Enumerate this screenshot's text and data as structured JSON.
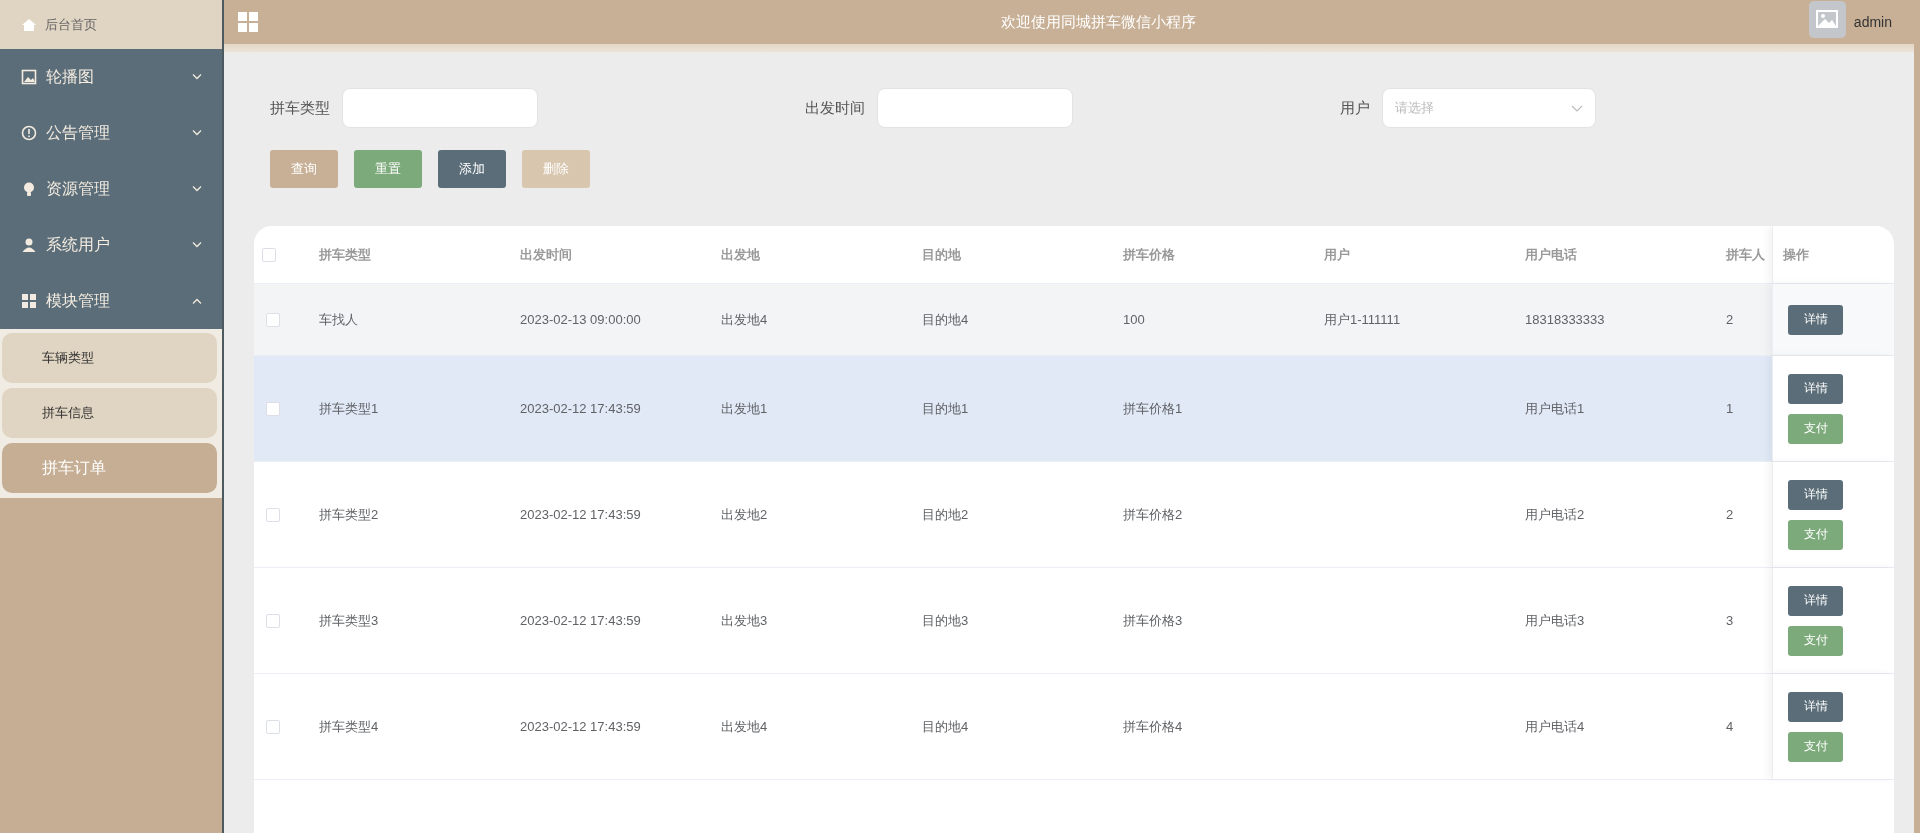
{
  "sidebar": {
    "home": {
      "label": "后台首页"
    },
    "items": [
      {
        "label": "轮播图",
        "expanded": false
      },
      {
        "label": "公告管理",
        "expanded": false
      },
      {
        "label": "资源管理",
        "expanded": false
      },
      {
        "label": "系统用户",
        "expanded": false
      },
      {
        "label": "模块管理",
        "expanded": true,
        "children": [
          {
            "label": "车辆类型",
            "selected": false
          },
          {
            "label": "拼车信息",
            "selected": false
          },
          {
            "label": "拼车订单",
            "selected": true
          }
        ]
      }
    ]
  },
  "header": {
    "title": "欢迎使用同城拼车微信小程序",
    "user": "admin"
  },
  "filters": [
    {
      "label": "拼车类型",
      "kind": "input"
    },
    {
      "label": "出发时间",
      "kind": "input"
    },
    {
      "label": "用户",
      "kind": "select",
      "placeholder": "请选择"
    }
  ],
  "buttons": [
    {
      "label": "查询",
      "kind": "search",
      "disabled": false
    },
    {
      "label": "重置",
      "kind": "reset",
      "disabled": false
    },
    {
      "label": "添加",
      "kind": "add",
      "disabled": false
    },
    {
      "label": "删除",
      "kind": "delete",
      "disabled": true
    }
  ],
  "table": {
    "select_all": {
      "checked": false
    },
    "columns": [
      "拼车类型",
      "出发时间",
      "出发地",
      "目的地",
      "拼车价格",
      "用户",
      "用户电话",
      "拼车人"
    ],
    "action_column": "操作",
    "rows": [
      {
        "checked": false,
        "striped": true,
        "hovered": false,
        "cells": [
          "车找人",
          "2023-02-13 09:00:00",
          "出发地4",
          "目的地4",
          "100",
          "用户1-111111",
          "18318333333",
          "2"
        ],
        "actions": [
          {
            "label": "详情",
            "kind": "detail"
          }
        ]
      },
      {
        "checked": false,
        "striped": false,
        "hovered": true,
        "cells": [
          "拼车类型1",
          "2023-02-12 17:43:59",
          "出发地1",
          "目的地1",
          "拼车价格1",
          "",
          "用户电话1",
          "1"
        ],
        "actions": [
          {
            "label": "详情",
            "kind": "detail"
          },
          {
            "label": "支付",
            "kind": "pay"
          }
        ]
      },
      {
        "checked": false,
        "striped": false,
        "hovered": false,
        "cells": [
          "拼车类型2",
          "2023-02-12 17:43:59",
          "出发地2",
          "目的地2",
          "拼车价格2",
          "",
          "用户电话2",
          "2"
        ],
        "actions": [
          {
            "label": "详情",
            "kind": "detail"
          },
          {
            "label": "支付",
            "kind": "pay"
          }
        ]
      },
      {
        "checked": false,
        "striped": false,
        "hovered": false,
        "cells": [
          "拼车类型3",
          "2023-02-12 17:43:59",
          "出发地3",
          "目的地3",
          "拼车价格3",
          "",
          "用户电话3",
          "3"
        ],
        "actions": [
          {
            "label": "详情",
            "kind": "detail"
          },
          {
            "label": "支付",
            "kind": "pay"
          }
        ]
      },
      {
        "checked": false,
        "striped": false,
        "hovered": false,
        "cells": [
          "拼车类型4",
          "2023-02-12 17:43:59",
          "出发地4",
          "目的地4",
          "拼车价格4",
          "",
          "用户电话4",
          "4"
        ],
        "actions": [
          {
            "label": "详情",
            "kind": "detail"
          },
          {
            "label": "支付",
            "kind": "pay"
          }
        ]
      }
    ]
  }
}
